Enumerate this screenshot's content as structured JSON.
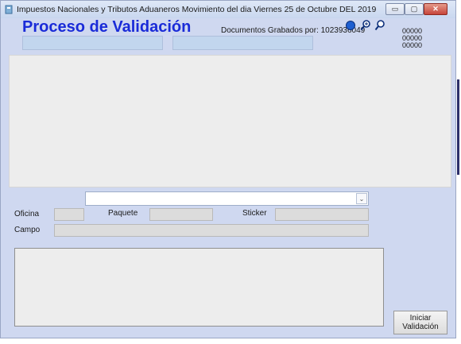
{
  "window": {
    "title": "Impuestos Nacionales y Tributos Aduaneros  Movimiento del dia Viernes 25 de Octubre DEL 2019",
    "controls": {
      "minimize": "▭",
      "maximize": "▢",
      "close": "✕"
    }
  },
  "header": {
    "title": "Proceso de Validación",
    "documents_label": "Documentos Grabados por: 1023936049",
    "counters": [
      "00000",
      "00000",
      "00000"
    ]
  },
  "form": {
    "combo_value": "",
    "combo_arrow": "⌄",
    "oficina_label": "Oficina",
    "paquete_label": "Paquete",
    "sticker_label": "Sticker",
    "campo_label": "Campo"
  },
  "buttons": {
    "iniciar_line1": "Iniciar",
    "iniciar_line2": "Validación"
  },
  "colors": {
    "window_bg": "#cfd8f0",
    "title_accent": "#1a2bd8",
    "close_button": "#c6443a"
  }
}
